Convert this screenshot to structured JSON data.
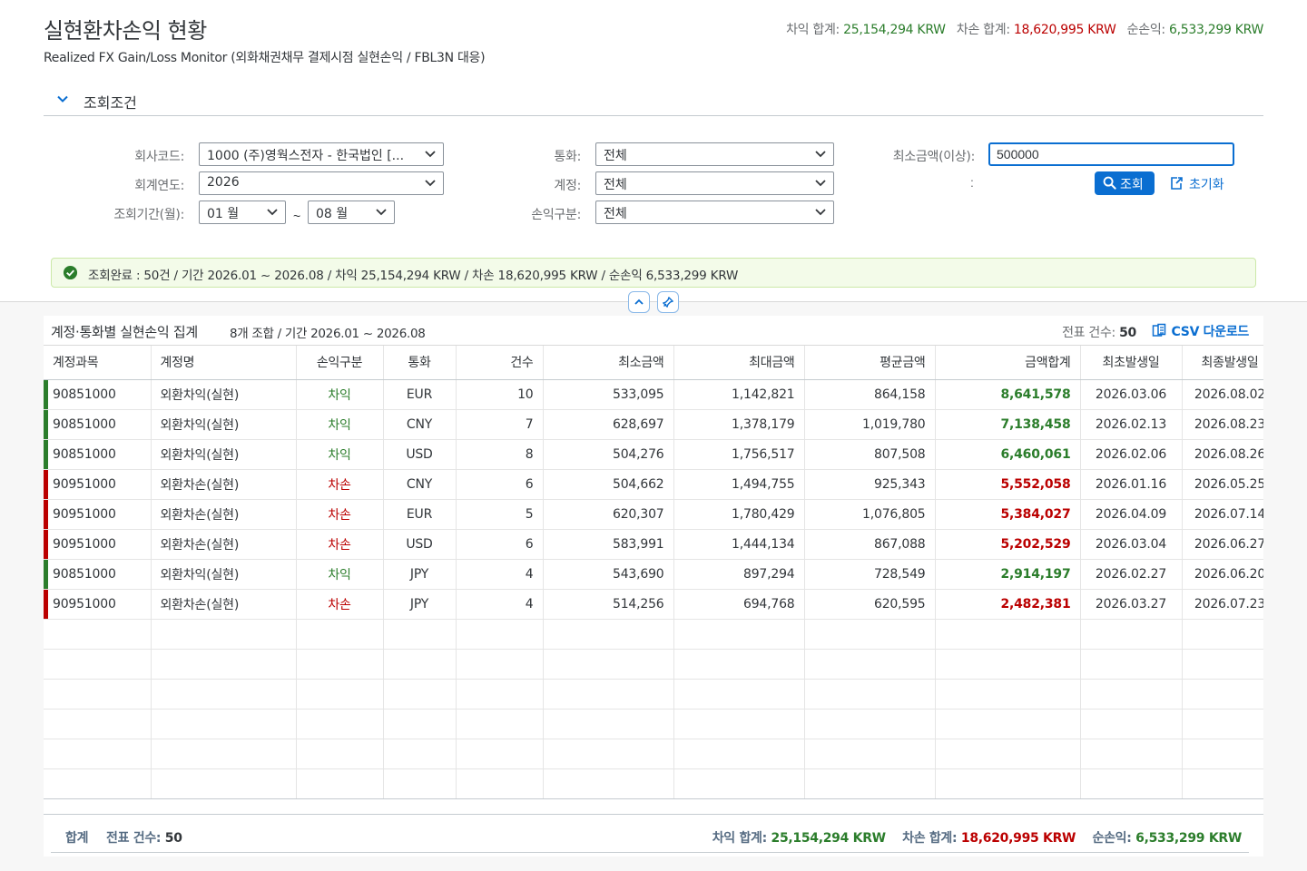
{
  "header": {
    "title": "실현환차손익 현황",
    "subtitle": "Realized FX Gain/Loss Monitor (외화채권채무 결제시점 실현손익 / FBL3N 대응)",
    "kpi": {
      "gain_label": "차익 합계:",
      "gain_value": "25,154,294 KRW",
      "loss_label": "차손 합계:",
      "loss_value": "18,620,995 KRW",
      "net_label": "순손익:",
      "net_value": "6,533,299 KRW"
    }
  },
  "filter": {
    "title": "조회조건",
    "company_label": "회사코드:",
    "company_value": "1000 (주)영웍스전자 - 한국법인 [...",
    "year_label": "회계연도:",
    "year_value": "2026",
    "period_label": "조회기간(월):",
    "period_from": "01 월",
    "period_sep": "~",
    "period_to": "08 월",
    "currency_label": "통화:",
    "currency_value": "전체",
    "account_label": "계정:",
    "account_value": "전체",
    "pl_label": "손익구분:",
    "pl_value": "전체",
    "min_amount_label": "최소금액(이상):",
    "min_amount_value": "500000",
    "colon": ":",
    "search_button": "조회",
    "reset_button": "초기화"
  },
  "message": {
    "text": "조회완료 : 50건 / 기간 2026.01 ~ 2026.08 / 차익 25,154,294 KRW / 차손 18,620,995 KRW / 순손익 6,533,299 KRW"
  },
  "table": {
    "title": "계정·통화별 실현손익 집계",
    "subtitle": "8개 조합 / 기간 2026.01 ~ 2026.08",
    "count_label": "전표 건수:",
    "count_value": "50",
    "csv_button": "CSV 다운로드",
    "columns": [
      "계정과목",
      "계정명",
      "손익구분",
      "통화",
      "건수",
      "최소금액",
      "최대금액",
      "평균금액",
      "금액합계",
      "최초발생일",
      "최종발생일"
    ],
    "rows": [
      {
        "type": "gain",
        "acct": "90851000",
        "name": "외환차익(실현)",
        "pl": "차익",
        "cur": "EUR",
        "cnt": "10",
        "min": "533,095",
        "max": "1,142,821",
        "avg": "864,158",
        "sum": "8,641,578",
        "first": "2026.03.06",
        "last": "2026.08.02"
      },
      {
        "type": "gain",
        "acct": "90851000",
        "name": "외환차익(실현)",
        "pl": "차익",
        "cur": "CNY",
        "cnt": "7",
        "min": "628,697",
        "max": "1,378,179",
        "avg": "1,019,780",
        "sum": "7,138,458",
        "first": "2026.02.13",
        "last": "2026.08.23"
      },
      {
        "type": "gain",
        "acct": "90851000",
        "name": "외환차익(실현)",
        "pl": "차익",
        "cur": "USD",
        "cnt": "8",
        "min": "504,276",
        "max": "1,756,517",
        "avg": "807,508",
        "sum": "6,460,061",
        "first": "2026.02.06",
        "last": "2026.08.26"
      },
      {
        "type": "loss",
        "acct": "90951000",
        "name": "외환차손(실현)",
        "pl": "차손",
        "cur": "CNY",
        "cnt": "6",
        "min": "504,662",
        "max": "1,494,755",
        "avg": "925,343",
        "sum": "5,552,058",
        "first": "2026.01.16",
        "last": "2026.05.25"
      },
      {
        "type": "loss",
        "acct": "90951000",
        "name": "외환차손(실현)",
        "pl": "차손",
        "cur": "EUR",
        "cnt": "5",
        "min": "620,307",
        "max": "1,780,429",
        "avg": "1,076,805",
        "sum": "5,384,027",
        "first": "2026.04.09",
        "last": "2026.07.14"
      },
      {
        "type": "loss",
        "acct": "90951000",
        "name": "외환차손(실현)",
        "pl": "차손",
        "cur": "USD",
        "cnt": "6",
        "min": "583,991",
        "max": "1,444,134",
        "avg": "867,088",
        "sum": "5,202,529",
        "first": "2026.03.04",
        "last": "2026.06.27"
      },
      {
        "type": "gain",
        "acct": "90851000",
        "name": "외환차익(실현)",
        "pl": "차익",
        "cur": "JPY",
        "cnt": "4",
        "min": "543,690",
        "max": "897,294",
        "avg": "728,549",
        "sum": "2,914,197",
        "first": "2026.02.27",
        "last": "2026.06.20"
      },
      {
        "type": "loss",
        "acct": "90951000",
        "name": "외환차손(실현)",
        "pl": "차손",
        "cur": "JPY",
        "cnt": "4",
        "min": "514,256",
        "max": "694,768",
        "avg": "620,595",
        "sum": "2,482,381",
        "first": "2026.03.27",
        "last": "2026.07.23"
      }
    ],
    "empty_rows": 6
  },
  "footer": {
    "total_label": "합계",
    "count_label": "전표 건수:",
    "count_value": "50",
    "gain_label": "차익 합계:",
    "gain_value": "25,154,294 KRW",
    "loss_label": "차손 합계:",
    "loss_value": "18,620,995 KRW",
    "net_label": "순손익:",
    "net_value": "6,533,299 KRW"
  },
  "colors": {
    "gain": "#2b7d2b",
    "loss": "#bb0000",
    "accent": "#0a6ed1"
  }
}
